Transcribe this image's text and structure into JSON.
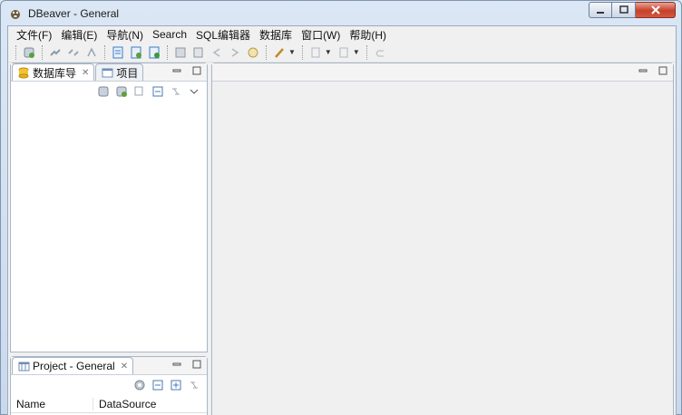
{
  "window": {
    "title": "DBeaver - General"
  },
  "menu": [
    "文件(F)",
    "编辑(E)",
    "导航(N)",
    "Search",
    "SQL编辑器",
    "数据库",
    "窗口(W)",
    "帮助(H)"
  ],
  "navigator": {
    "tab_label": "数据库导",
    "tab2_label": "项目"
  },
  "project": {
    "tab_label": "Project - General",
    "columns": [
      "Name",
      "DataSource"
    ]
  },
  "colors": {
    "frame": "#dbe7f4",
    "panel_border": "#a9b6c6",
    "close_button": "#c6402a"
  }
}
